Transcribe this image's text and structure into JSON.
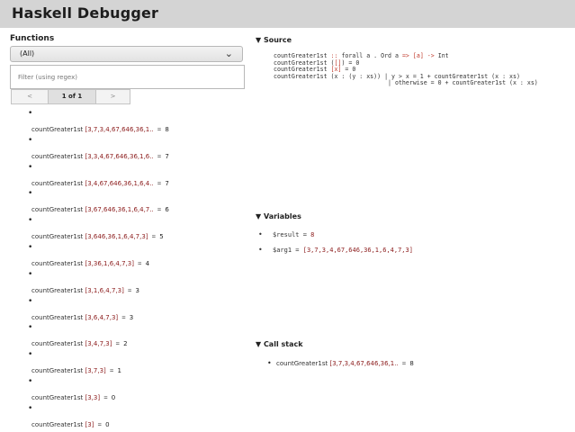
{
  "app": {
    "title": "Haskell Debugger"
  },
  "functions": {
    "title": "Functions",
    "select_value": "(All)",
    "filter_placeholder": "Filter (using regex)",
    "pager": {
      "prev": "<",
      "page": "1 of 1",
      "next": ">"
    },
    "calls": [
      {
        "name": "countGreater1st",
        "args": "[3,7,3,4,67,646,36,1..",
        "eq": "=",
        "result": "8"
      },
      {
        "name": "countGreater1st",
        "args": "[3,3,4,67,646,36,1,6..",
        "eq": "=",
        "result": "7"
      },
      {
        "name": "countGreater1st",
        "args": "[3,4,67,646,36,1,6,4..",
        "eq": "=",
        "result": "7"
      },
      {
        "name": "countGreater1st",
        "args": "[3,67,646,36,1,6,4,7..",
        "eq": "=",
        "result": "6"
      },
      {
        "name": "countGreater1st",
        "args": "[3,646,36,1,6,4,7,3]",
        "eq": "=",
        "result": "5"
      },
      {
        "name": "countGreater1st",
        "args": "[3,36,1,6,4,7,3]",
        "eq": "=",
        "result": "4"
      },
      {
        "name": "countGreater1st",
        "args": "[3,1,6,4,7,3]",
        "eq": "=",
        "result": "3"
      },
      {
        "name": "countGreater1st",
        "args": "[3,6,4,7,3]",
        "eq": "=",
        "result": "3"
      },
      {
        "name": "countGreater1st",
        "args": "[3,4,7,3]",
        "eq": "=",
        "result": "2"
      },
      {
        "name": "countGreater1st",
        "args": "[3,7,3]",
        "eq": "=",
        "result": "1"
      },
      {
        "name": "countGreater1st",
        "args": "[3,3]",
        "eq": "=",
        "result": "0"
      },
      {
        "name": "countGreater1st",
        "args": "[3]",
        "eq": "=",
        "result": "0"
      }
    ]
  },
  "source": {
    "title": "▼ Source",
    "lines": [
      [
        {
          "t": "countGreater1st ",
          "k": false
        },
        {
          "t": "::",
          "k": true
        },
        {
          "t": " forall a . Ord a ",
          "k": false
        },
        {
          "t": "=>",
          "k": true
        },
        {
          "t": " ",
          "k": false
        },
        {
          "t": "[a]",
          "k": true
        },
        {
          "t": " ",
          "k": false
        },
        {
          "t": "->",
          "k": true
        },
        {
          "t": " Int",
          "k": false
        }
      ],
      [
        {
          "t": "countGreater1st (",
          "k": false
        },
        {
          "t": "[]",
          "k": true
        },
        {
          "t": ") = 0",
          "k": false
        }
      ],
      [
        {
          "t": "countGreater1st ",
          "k": false
        },
        {
          "t": "[x]",
          "k": true
        },
        {
          "t": " = 0",
          "k": false
        }
      ],
      [
        {
          "t": "countGreater1st (x : (y : xs)) | y > x = 1 + countGreater1st (x : xs)",
          "k": false
        }
      ],
      [
        {
          "t": "                                | otherwise = 0 + countGreater1st (x : xs)",
          "k": false
        }
      ]
    ]
  },
  "variables": {
    "title": "▼ Variables",
    "items": [
      {
        "name": "$result",
        "eq": "=",
        "value": "8"
      },
      {
        "name": "$arg1",
        "eq": "=",
        "value": "[3,7,3,4,67,646,36,1,6,4,7,3]"
      }
    ]
  },
  "callstack": {
    "title": "▼ Call stack",
    "items": [
      {
        "name": "countGreater1st",
        "args": "[3,7,3,4,67,646,36,1..",
        "eq": "=",
        "result": "8"
      }
    ]
  },
  "bullet": "•"
}
